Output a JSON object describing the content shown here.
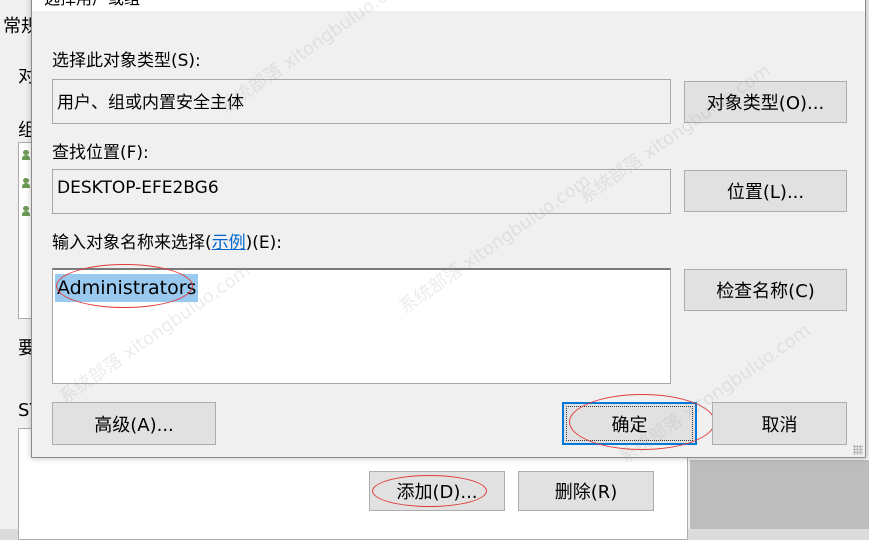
{
  "background_window": {
    "tab_label": "常规",
    "label_1": "对",
    "label_2": "组",
    "label_3": "要",
    "label_4": "SY",
    "add_button": "添加(D)...",
    "remove_button": "删除(R)"
  },
  "dialog": {
    "title": "选择用户或组",
    "object_type_label": "选择此对象类型(S):",
    "object_type_value": "用户、组或内置安全主体",
    "object_types_button": "对象类型(O)...",
    "location_label": "查找位置(F):",
    "location_value": "DESKTOP-EFE2BG6",
    "location_button": "位置(L)...",
    "names_label_prefix": "输入对象名称来选择(",
    "names_label_link": "示例",
    "names_label_suffix": ")(E):",
    "names_value": "Administrators",
    "check_names_button": "检查名称(C)",
    "advanced_button": "高级(A)...",
    "ok_button": "确定",
    "cancel_button": "取消"
  },
  "watermark": {
    "text": "系统部落 xitongbuluo.com"
  },
  "colors": {
    "selection": "#99c9ef",
    "annotation": "#e23b3b",
    "link": "#0066cc",
    "default_button_border": "#0078d7"
  }
}
